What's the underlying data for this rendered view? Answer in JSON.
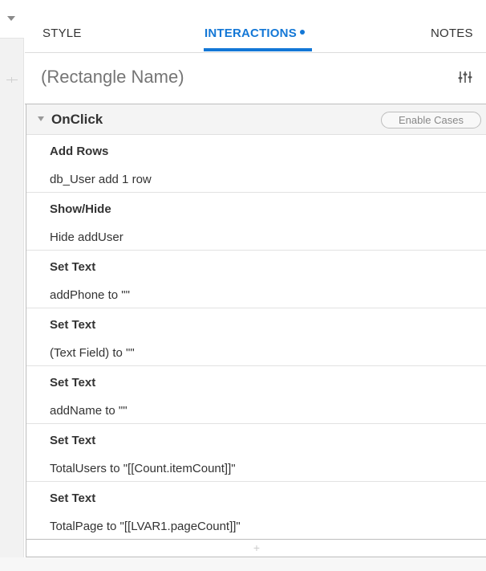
{
  "tabs": {
    "style": "STYLE",
    "interactions": "INTERACTIONS",
    "notes": "NOTES",
    "active": "interactions"
  },
  "widget": {
    "name_placeholder": "(Rectangle Name)"
  },
  "event": {
    "title": "OnClick",
    "enable_cases": "Enable Cases"
  },
  "actions": [
    {
      "name": "Add Rows",
      "detail": "db_User add 1 row"
    },
    {
      "name": "Show/Hide",
      "detail": "Hide addUser"
    },
    {
      "name": "Set Text",
      "detail": "addPhone to \"\""
    },
    {
      "name": "Set Text",
      "detail": "(Text Field) to \"\""
    },
    {
      "name": "Set Text",
      "detail": "addName to \"\""
    },
    {
      "name": "Set Text",
      "detail": "TotalUsers to \"[[Count.itemCount]]\""
    },
    {
      "name": "Set Text",
      "detail": "TotalPage to \"[[LVAR1.pageCount]]\""
    }
  ],
  "add_action": "+",
  "colors": {
    "accent": "#1377d6",
    "text": "#333333",
    "placeholder": "#b3b3b3",
    "header_bg": "#f4f4f4"
  }
}
